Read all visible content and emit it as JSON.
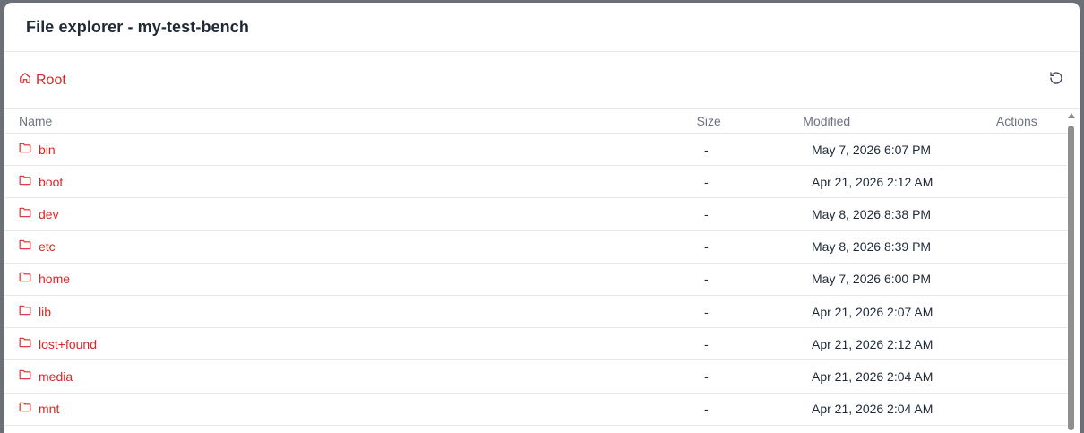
{
  "modal": {
    "title": "File explorer - my-test-bench"
  },
  "toolbar": {
    "breadcrumb_root": "Root",
    "breadcrumb_icon": "home-icon",
    "refresh_icon": "refresh-icon"
  },
  "table": {
    "headers": {
      "name": "Name",
      "size": "Size",
      "modified": "Modified",
      "actions": "Actions"
    },
    "rows": [
      {
        "name": "bin",
        "size": "-",
        "modified": "May 7, 2026 6:07 PM"
      },
      {
        "name": "boot",
        "size": "-",
        "modified": "Apr 21, 2026 2:12 AM"
      },
      {
        "name": "dev",
        "size": "-",
        "modified": "May 8, 2026 8:38 PM"
      },
      {
        "name": "etc",
        "size": "-",
        "modified": "May 8, 2026 8:39 PM"
      },
      {
        "name": "home",
        "size": "-",
        "modified": "May 7, 2026 6:00 PM"
      },
      {
        "name": "lib",
        "size": "-",
        "modified": "Apr 21, 2026 2:07 AM"
      },
      {
        "name": "lost+found",
        "size": "-",
        "modified": "Apr 21, 2026 2:12 AM"
      },
      {
        "name": "media",
        "size": "-",
        "modified": "Apr 21, 2026 2:04 AM"
      },
      {
        "name": "mnt",
        "size": "-",
        "modified": "Apr 21, 2026 2:04 AM"
      }
    ]
  },
  "colors": {
    "accent": "#dc2626",
    "text": "#1f2937",
    "muted": "#6b7280",
    "border": "#e5e7eb"
  }
}
